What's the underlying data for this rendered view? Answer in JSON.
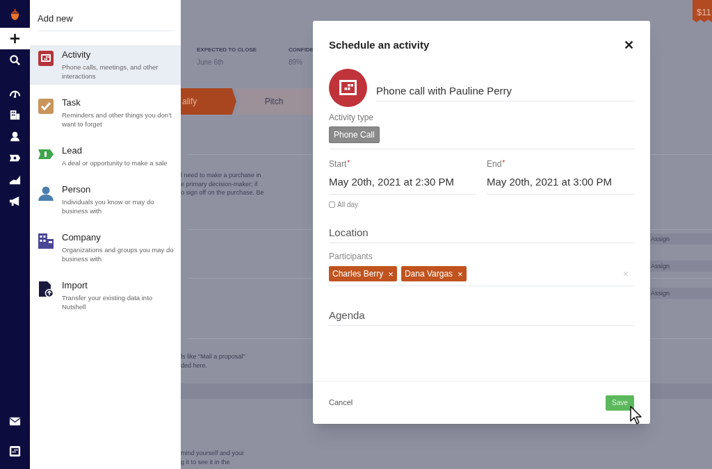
{
  "nav": {
    "items": [
      {
        "kind": "logo",
        "selected": false
      },
      {
        "kind": "add",
        "selected": true
      },
      {
        "kind": "search",
        "selected": false
      },
      {
        "kind": "gauge",
        "selected": false
      },
      {
        "kind": "company",
        "selected": false
      },
      {
        "kind": "person",
        "selected": false
      },
      {
        "kind": "lead",
        "selected": false
      },
      {
        "kind": "chart",
        "selected": false
      },
      {
        "kind": "megaphone",
        "selected": false
      }
    ],
    "bottom_items": [
      {
        "kind": "mail",
        "selected": false
      },
      {
        "kind": "calendar",
        "selected": false
      }
    ]
  },
  "add_panel": {
    "title": "Add new",
    "items": [
      {
        "kind": "activity",
        "title": "Activity",
        "description": "Phone calls, meetings, and other interactions",
        "selected": true
      },
      {
        "kind": "task",
        "title": "Task",
        "description": "Reminders and other things you don't want to forget",
        "selected": false
      },
      {
        "kind": "lead",
        "title": "Lead",
        "description": "A deal or opportunity to make a sale",
        "selected": false
      },
      {
        "kind": "person",
        "title": "Person",
        "description": "Individuals you know or may do business with",
        "selected": false
      },
      {
        "kind": "company",
        "title": "Company",
        "description": "Organizations and groups you may do business with",
        "selected": false
      },
      {
        "kind": "import",
        "title": "Import",
        "description": "Transfer your existing data into Nutshell",
        "selected": false
      }
    ]
  },
  "background": {
    "price_tag": "$11",
    "summary": [
      {
        "label": "EXPECTED TO CLOSE",
        "value": "June 6th"
      },
      {
        "label": "CONFIDE",
        "value": "89%"
      }
    ],
    "stages": [
      {
        "label": "alify",
        "selected": true
      },
      {
        "label": "Pitch",
        "selected": false
      }
    ],
    "paragraphs": [
      {
        "lines": [
          "l need to make a purchase in",
          "e primary decision-maker; if",
          "o sign off on the purchase. Be"
        ]
      },
      {
        "lines": [
          "ls like \"Mail a proposal\"",
          "ded here."
        ]
      },
      {
        "lines": [
          "mind yourself and your",
          "g it to see it in the"
        ]
      }
    ],
    "assign_buttons": [
      "Assign",
      "Assign",
      "Assign"
    ]
  },
  "modal": {
    "title": "Schedule an activity",
    "close": "✕",
    "name": "Phone call with Pauline Perry",
    "activity_type": {
      "label": "Activity type",
      "value": "Phone Call"
    },
    "start": {
      "label": "Start",
      "required_mark": "*",
      "value": "May 20th, 2021 at 2:30 PM"
    },
    "end": {
      "label": "End",
      "required_mark": "*",
      "value": "May 20th, 2021 at 3:00 PM"
    },
    "all_day": {
      "label": "All day",
      "checked": false
    },
    "location": {
      "placeholder": "Location"
    },
    "participants": {
      "label": "Participants",
      "chips": [
        {
          "name": "Charles Berry",
          "remove": "×"
        },
        {
          "name": "Dana Vargas",
          "remove": "×"
        }
      ],
      "clear": "×"
    },
    "agenda": {
      "placeholder": "Agenda"
    },
    "cancel": "Cancel",
    "save": "Save"
  }
}
